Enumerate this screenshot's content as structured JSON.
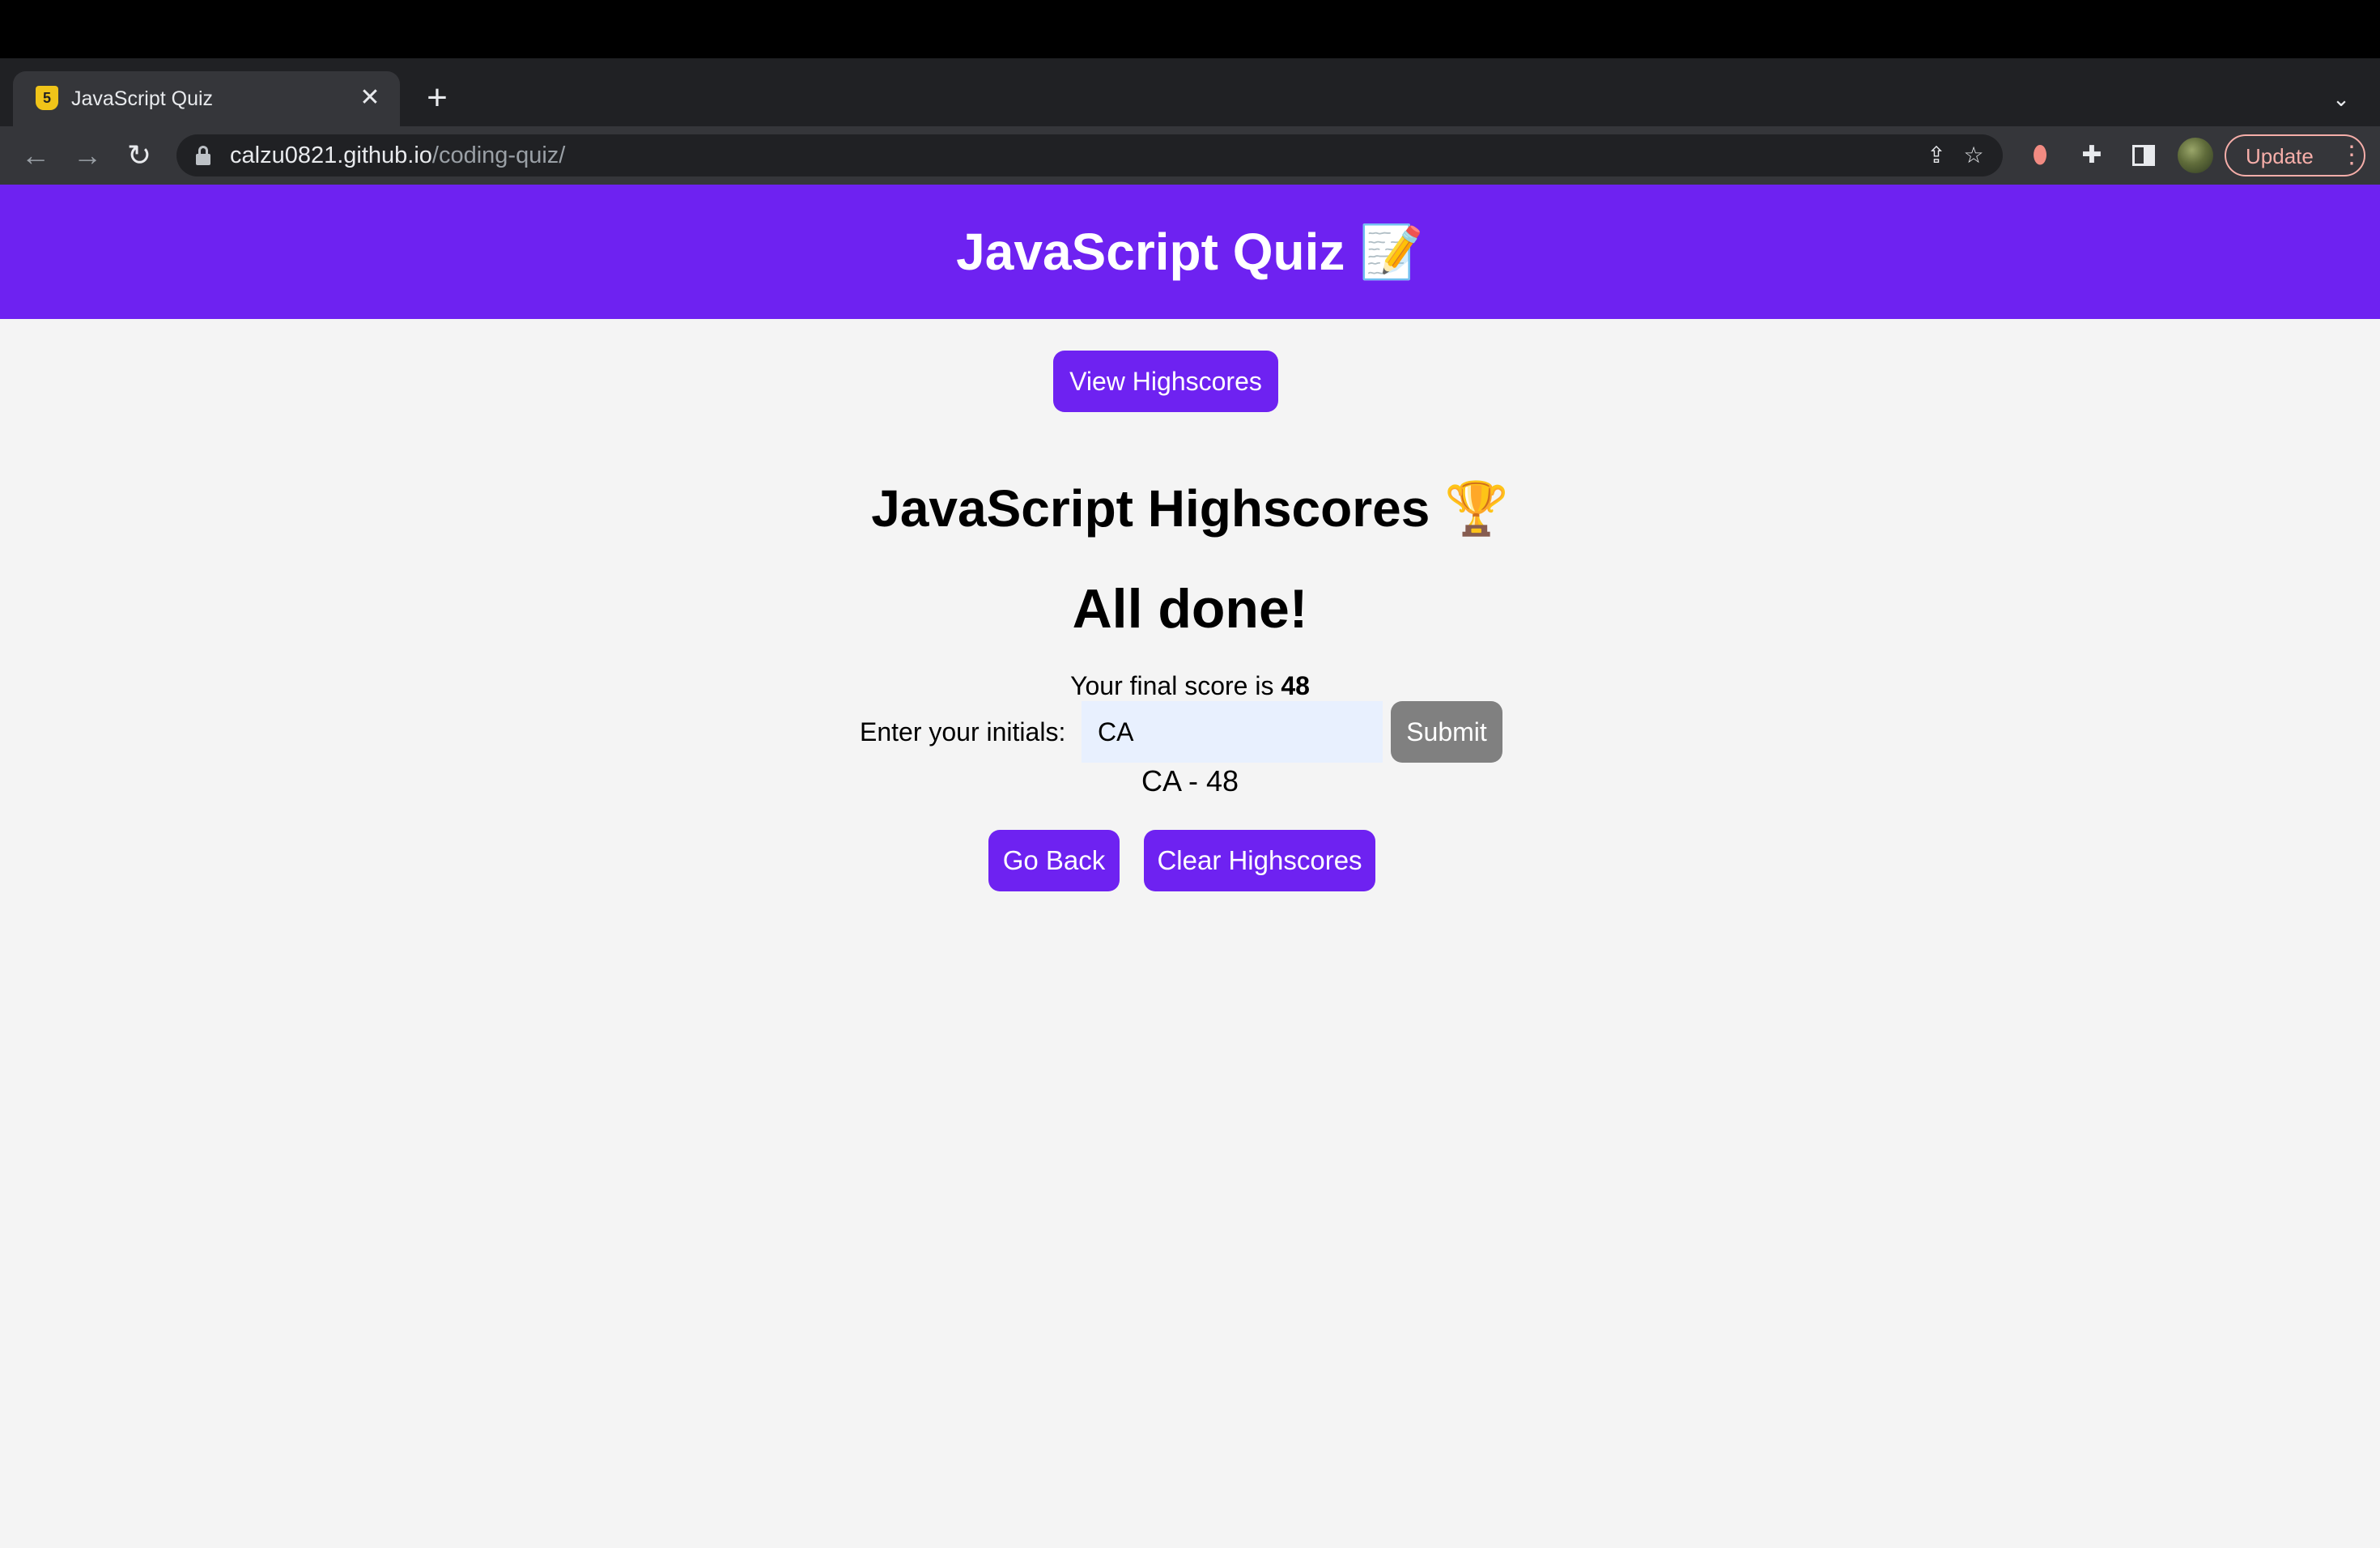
{
  "browser": {
    "tab": {
      "favicon": "5",
      "title": "JavaScript Quiz",
      "close_glyph": "✕"
    },
    "new_tab_glyph": "+",
    "tab_list_glyph": "⌄",
    "nav": {
      "back": "←",
      "forward": "→",
      "reload": "↻"
    },
    "url": {
      "host": "calzu0821.github.io",
      "path": "/coding-quiz/"
    },
    "omnibox_icons": {
      "share": "⇪",
      "bookmark": "☆"
    },
    "toolbar_icons": {
      "extension_record": "⬮",
      "extensions": "✚"
    },
    "update_button": {
      "label": "Update",
      "menu_glyph": "⋮"
    },
    "accent_colors": {
      "update": "#f6aea9"
    }
  },
  "page": {
    "brand_color": "#6e22f1",
    "header_title": "JavaScript Quiz 📝",
    "view_highscores": "View Highscores",
    "highscores_heading": "JavaScript Highscores 🏆",
    "all_done": "All done!",
    "final_score_prefix": "Your final score is",
    "final_score_value": "48",
    "initials_label": "Enter your initials:",
    "initials_value": "CA",
    "submit": "Submit",
    "score_entry": "CA - 48",
    "go_back": "Go Back",
    "clear_highscores": "Clear Highscores"
  }
}
